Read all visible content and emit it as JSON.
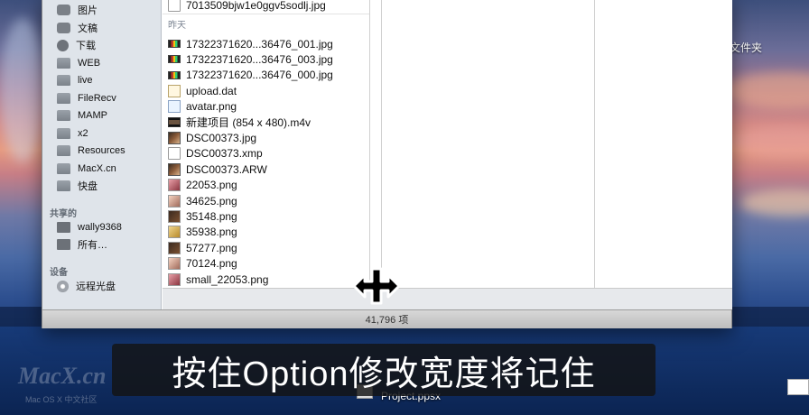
{
  "desktop": {
    "folder_label": "文件夹",
    "file_label": "Project.ppsx",
    "watermark": "MacX.cn",
    "watermark_sub": "Mac OS X 中文社区"
  },
  "sidebar": {
    "items_top": [
      {
        "label": "图片",
        "icon": "camera-icon"
      },
      {
        "label": "文稿",
        "icon": "documents-icon"
      },
      {
        "label": "下载",
        "icon": "download-icon"
      },
      {
        "label": "WEB",
        "icon": "folder-icon"
      },
      {
        "label": "live",
        "icon": "folder-icon"
      },
      {
        "label": "FileRecv",
        "icon": "folder-icon"
      },
      {
        "label": "MAMP",
        "icon": "folder-icon"
      },
      {
        "label": "x2",
        "icon": "folder-icon"
      },
      {
        "label": "Resources",
        "icon": "folder-icon"
      },
      {
        "label": "MacX.cn",
        "icon": "folder-icon"
      },
      {
        "label": "快盘",
        "icon": "folder-icon"
      }
    ],
    "shared_heading": "共享的",
    "shared_items": [
      {
        "label": "wally9368",
        "icon": "monitor-icon"
      },
      {
        "label": "所有…",
        "icon": "network-icon"
      }
    ],
    "devices_heading": "设备",
    "device_items": [
      {
        "label": "远程光盘",
        "icon": "disc-icon"
      }
    ]
  },
  "column": {
    "top_file": "7013509bjw1e0ggv5sodlj.jpg",
    "section": "昨天",
    "files": [
      {
        "name": "17322371620...36476_001.jpg",
        "icon": "strip"
      },
      {
        "name": "17322371620...36476_003.jpg",
        "icon": "strip"
      },
      {
        "name": "17322371620...36476_000.jpg",
        "icon": "strip"
      },
      {
        "name": "upload.dat",
        "icon": "dat"
      },
      {
        "name": "avatar.png",
        "icon": "png"
      },
      {
        "name": "新建项目 (854 x 480).m4v",
        "icon": "movie"
      },
      {
        "name": "DSC00373.jpg",
        "icon": "photo"
      },
      {
        "name": "DSC00373.xmp",
        "icon": "doc"
      },
      {
        "name": "DSC00373.ARW",
        "icon": "photo"
      },
      {
        "name": "22053.png",
        "icon": "pink"
      },
      {
        "name": "34625.png",
        "icon": "face"
      },
      {
        "name": "35148.png",
        "icon": "dark"
      },
      {
        "name": "35938.png",
        "icon": "gold"
      },
      {
        "name": "57277.png",
        "icon": "dark"
      },
      {
        "name": "70124.png",
        "icon": "face"
      },
      {
        "name": "small_22053.png",
        "icon": "pink"
      }
    ]
  },
  "status": {
    "count": "41,796 项"
  },
  "caption": "按住Option修改宽度将记住"
}
